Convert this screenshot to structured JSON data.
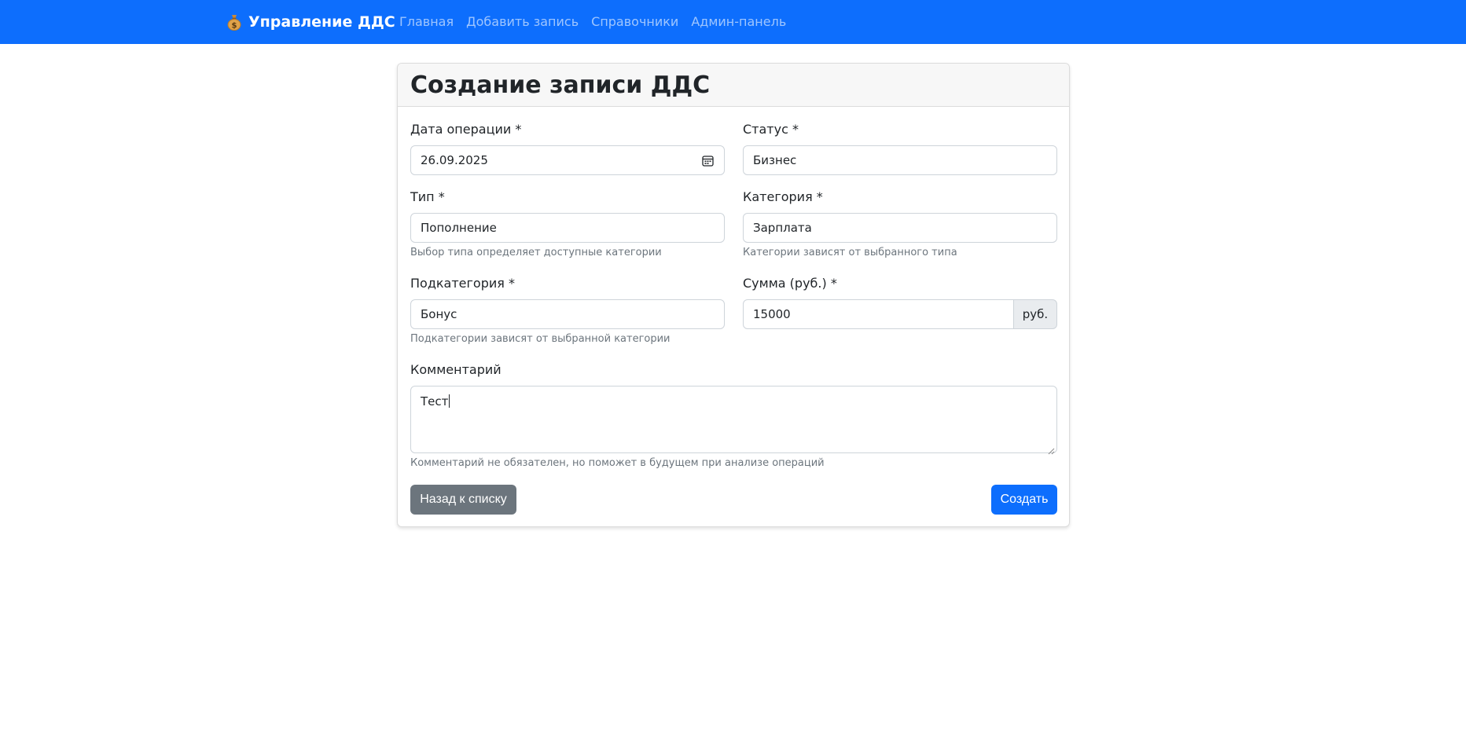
{
  "navbar": {
    "brand_icon": "money-bag-icon",
    "brand": "Управление ДДС",
    "links": [
      {
        "label": "Главная"
      },
      {
        "label": "Добавить запись"
      },
      {
        "label": "Справочники"
      },
      {
        "label": "Админ-панель"
      }
    ],
    "background_color": "#0d6efd"
  },
  "form": {
    "title": "Создание записи ДДС",
    "date": {
      "label": "Дата операции *",
      "value": "26.09.2025",
      "icon": "calendar-icon"
    },
    "status": {
      "label": "Статус *",
      "value": "Бизнес"
    },
    "type": {
      "label": "Тип *",
      "value": "Пополнение",
      "hint": "Выбор типа определяет доступные категории"
    },
    "category": {
      "label": "Категория *",
      "value": "Зарплата",
      "hint": "Категории зависят от выбранного типа"
    },
    "subcategory": {
      "label": "Подкатегория *",
      "value": "Бонус",
      "hint": "Подкатегории зависят от выбранной категории"
    },
    "amount": {
      "label": "Сумма (руб.) *",
      "value": "15000",
      "unit": "руб."
    },
    "comment": {
      "label": "Комментарий",
      "value": "Тест",
      "hint": "Комментарий не обязателен, но поможет в будущем при анализе операций"
    },
    "back_button": "Назад к списку",
    "create_button": "Создать"
  }
}
